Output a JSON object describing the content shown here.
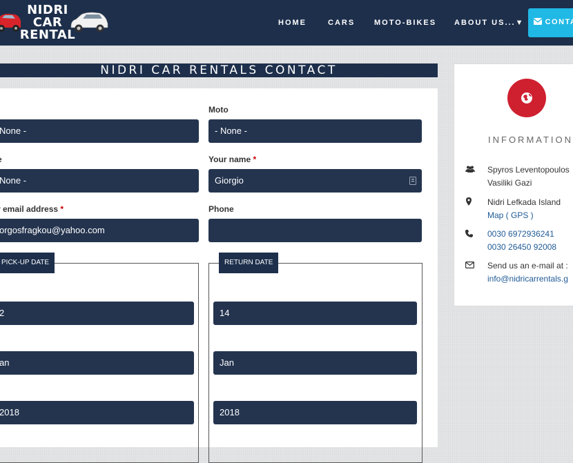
{
  "brand": {
    "line1": "NIDRI",
    "line2": "CAR",
    "line3": "RENTAL"
  },
  "nav": {
    "home": "HOME",
    "cars": "CARS",
    "moto": "MOTO-BIKES",
    "about": "ABOUT US...▼",
    "contact": "CONTA"
  },
  "page_title": "NIDRI CAR RENTALS CONTACT",
  "form": {
    "car_select_value": "None -",
    "moto_label": "Moto",
    "moto_select_value": "- None -",
    "title_label_partial": "e",
    "title_select_value": "None -",
    "name_label": "Your name",
    "name_value": "Giorgio",
    "email_label_partial": "r email address",
    "email_value": "orgosfragkou@yahoo.com",
    "phone_label": "Phone",
    "phone_value": "",
    "required_mark": "*",
    "pickup": {
      "legend": "PICK-UP DATE",
      "day": "2",
      "month": "an",
      "year": "2018"
    },
    "return": {
      "legend": "RETURN DATE",
      "day": "14",
      "month": "Jan",
      "year": "2018"
    }
  },
  "info": {
    "heading": "INFORMATION",
    "contacts_line1": "Spyros Leventopoulos",
    "contacts_line2": "Vasiliki Gazi",
    "location_line1": "Nidri Lefkada Island",
    "location_link": "Map ( GPS )",
    "phone1": "0030 6972936241",
    "phone2": "0030 26450 92008",
    "email_prompt": "Send us an e-mail at :",
    "email_link": "info@nidricarrentals.g"
  },
  "colors": {
    "navy": "#1d2f4b",
    "field": "#24344f",
    "accent": "#20b8e5",
    "red": "#cf2030"
  }
}
